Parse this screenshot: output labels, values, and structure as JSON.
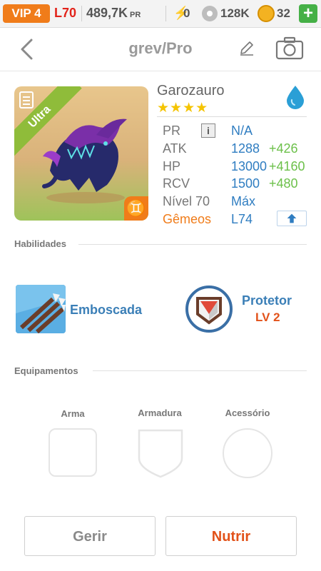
{
  "status_bar": {
    "vip": "VIP 4",
    "level": "L70",
    "power": "489,7K",
    "power_unit": "PR",
    "energy": "0",
    "food": "128K",
    "coins": "32",
    "add_label": "+"
  },
  "header": {
    "title": "grev/Pro",
    "icons": [
      "back-arrow",
      "pencil",
      "camera"
    ]
  },
  "dragon": {
    "name": "Garozauro",
    "rarity": "Ultra",
    "stars": 4,
    "stars_text": "★★★★",
    "element": "water",
    "zodiac_symbol": "♊",
    "stats": {
      "pr_label": "PR",
      "pr_info": "i",
      "pr_value": "N/A",
      "atk_label": "ATK",
      "atk_value": "1288",
      "atk_bonus": "+426",
      "hp_label": "HP",
      "hp_value": "13000",
      "hp_bonus": "+4160",
      "rcv_label": "RCV",
      "rcv_value": "1500",
      "rcv_bonus": "+480",
      "level_label": "Nível 70",
      "level_value": "Máx",
      "twin_label": "Gêmeos",
      "twin_value": "L74"
    }
  },
  "abilities": {
    "section_title": "Habilidades",
    "items": [
      {
        "name": "Emboscada"
      },
      {
        "name": "Protetor",
        "level": "LV 2"
      }
    ]
  },
  "equipment": {
    "section_title": "Equipamentos",
    "slots": [
      {
        "label": "Arma"
      },
      {
        "label": "Armadura"
      },
      {
        "label": "Acessório"
      }
    ]
  },
  "actions": {
    "manage": "Gerir",
    "feed": "Nutrir"
  },
  "colors": {
    "accent_orange": "#f07c1a",
    "stat_blue": "#2f7dc1",
    "bonus_green": "#6cc04a",
    "level_red": "#e2231a"
  }
}
